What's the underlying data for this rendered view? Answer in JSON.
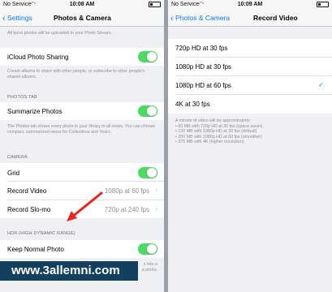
{
  "left": {
    "status": {
      "carrier": "No Service",
      "time": "10:08 AM",
      "battery": "91%"
    },
    "nav": {
      "back": "Settings",
      "title": "Photos & Camera"
    },
    "top_footer": "All burst photos will be uploaded to your Photo Stream.",
    "icloud": {
      "label": "iCloud Photo Sharing",
      "on": true,
      "footer": "Create albums to share with other people, or subscribe to other people's shared albums."
    },
    "photos_tab": {
      "header": "PHOTOS TAB",
      "label": "Summarize Photos",
      "on": true,
      "footer": "The Photos tab shows every photo in your library in all views. You can choose compact, summarized views for Collections and Years."
    },
    "camera": {
      "header": "CAMERA",
      "grid_label": "Grid",
      "grid_on": true,
      "record_video_label": "Record Video",
      "record_video_value": "1080p at 60 fps",
      "record_slomo_label": "Record Slo-mo",
      "record_slomo_value": "720p at 240 fps"
    },
    "hdr": {
      "header": "HDR (HIGH DYNAMIC RANGE)",
      "label": "Keep Normal Photo",
      "on": true,
      "footer_fragment": "s into a",
      "footer_fragment2": "a photo."
    }
  },
  "right": {
    "status": {
      "carrier": "No Service",
      "time": "10:09 AM",
      "battery": "91%"
    },
    "nav": {
      "back": "Photos & Camera",
      "title": "Record Video"
    },
    "options": [
      {
        "label": "720p HD at 30 fps",
        "selected": false
      },
      {
        "label": "1080p HD at 30 fps",
        "selected": false
      },
      {
        "label": "1080p HD at 60 fps",
        "selected": true
      },
      {
        "label": "4K at 30 fps",
        "selected": false
      }
    ],
    "footer_title": "A minute of video will be approximately:",
    "footer_lines": [
      "• 60 MB with 720p HD at 30 fps (space saver)",
      "• 130 MB with 1080p HD at 30 fps (default)",
      "• 200 MB with 1080p HD at 60 fps (smoother)",
      "• 375 MB with 4K (higher resolution)"
    ]
  },
  "watermark": "www.3allemni.com",
  "colors": {
    "accent": "#0a7aff",
    "toggle_on": "#4cd964",
    "watermark_bg": "#12405e",
    "arrow": "#e8251f"
  }
}
